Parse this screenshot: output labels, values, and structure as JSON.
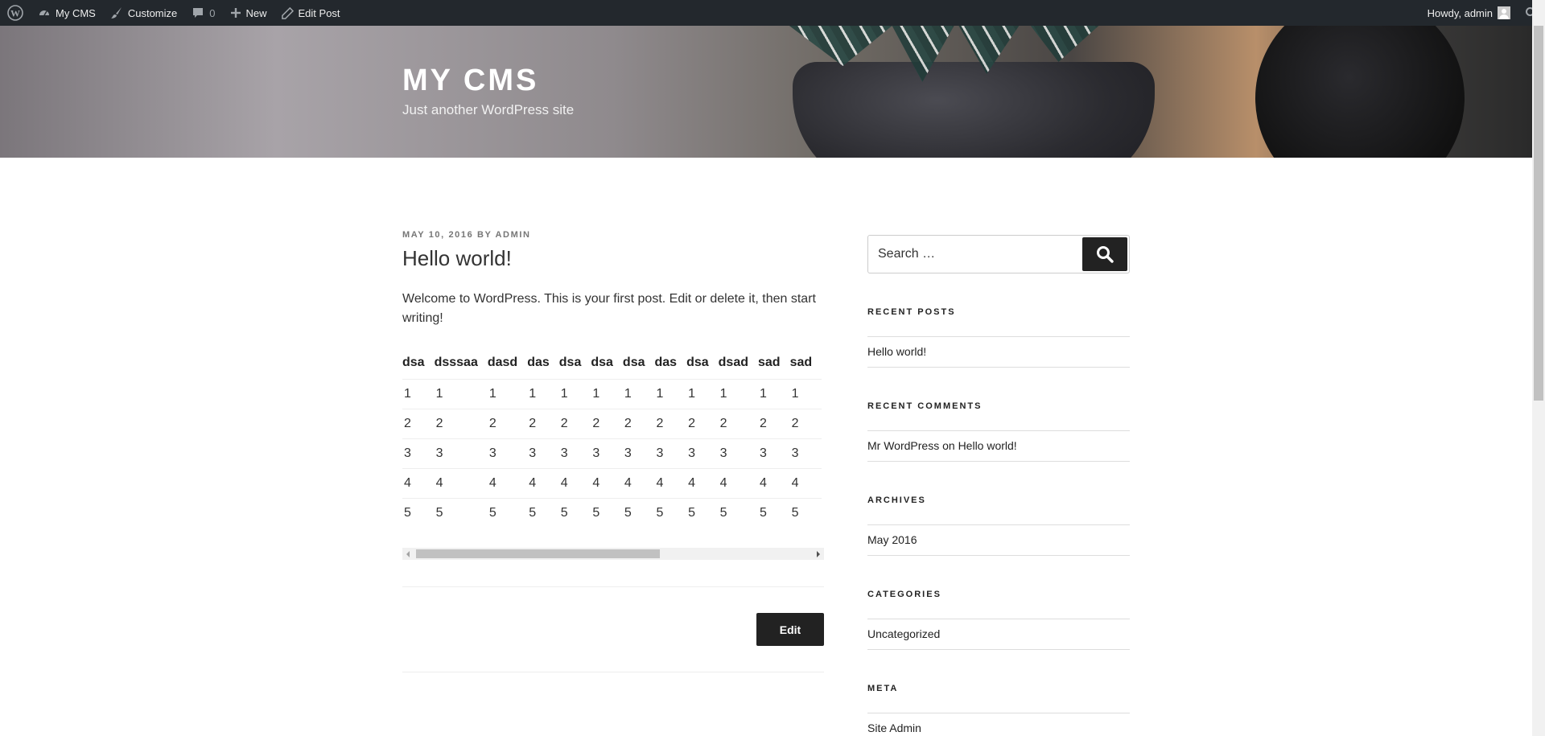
{
  "adminbar": {
    "left": [
      {
        "name": "wordpress-logo",
        "label": ""
      },
      {
        "name": "site-name",
        "label": "My CMS"
      },
      {
        "name": "customize",
        "label": "Customize"
      },
      {
        "name": "comments",
        "label": "0"
      },
      {
        "name": "new",
        "label": "New"
      },
      {
        "name": "edit-post",
        "label": "Edit Post"
      }
    ],
    "greeting": "Howdy, admin"
  },
  "site": {
    "title": "MY CMS",
    "description": "Just another WordPress site"
  },
  "post": {
    "date": "MAY 10, 2016",
    "by": "BY",
    "author": "ADMIN",
    "title": "Hello world!",
    "body": "Welcome to WordPress. This is your first post. Edit or delete it, then start writing!",
    "table": {
      "headers": [
        "dsa",
        "dsssaa",
        "dasd",
        "das",
        "dsa",
        "dsa",
        "dsa",
        "das",
        "dsa",
        "dsad",
        "sad",
        "sad"
      ],
      "rows": [
        [
          "1",
          "1",
          "1",
          "1",
          "1",
          "1",
          "1",
          "1",
          "1",
          "1",
          "1",
          "1"
        ],
        [
          "2",
          "2",
          "2",
          "2",
          "2",
          "2",
          "2",
          "2",
          "2",
          "2",
          "2",
          "2"
        ],
        [
          "3",
          "3",
          "3",
          "3",
          "3",
          "3",
          "3",
          "3",
          "3",
          "3",
          "3",
          "3"
        ],
        [
          "4",
          "4",
          "4",
          "4",
          "4",
          "4",
          "4",
          "4",
          "4",
          "4",
          "4",
          "4"
        ],
        [
          "5",
          "5",
          "5",
          "5",
          "5",
          "5",
          "5",
          "5",
          "5",
          "5",
          "5",
          "5"
        ]
      ]
    },
    "edit_label": "Edit"
  },
  "sidebar": {
    "search_placeholder": "Search …",
    "recent_posts": {
      "title": "RECENT POSTS",
      "items": [
        "Hello world!"
      ]
    },
    "recent_comments": {
      "title": "RECENT COMMENTS",
      "author": "Mr WordPress",
      "on": "on",
      "post": "Hello world!"
    },
    "archives": {
      "title": "ARCHIVES",
      "items": [
        "May 2016"
      ]
    },
    "categories": {
      "title": "CATEGORIES",
      "items": [
        "Uncategorized"
      ]
    },
    "meta": {
      "title": "META",
      "items": [
        "Site Admin"
      ]
    }
  },
  "colors": {
    "adminbar_bg": "#23282d",
    "button_bg": "#222222",
    "text": "#333333"
  }
}
